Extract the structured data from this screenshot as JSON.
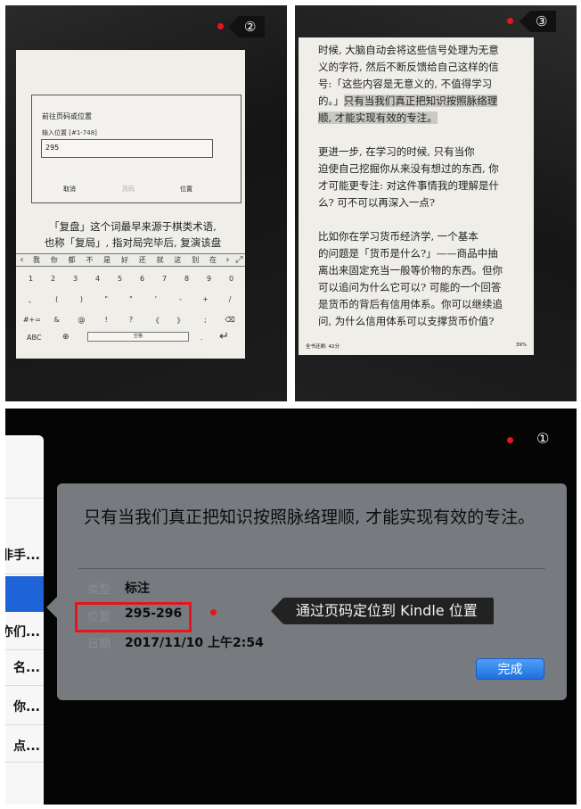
{
  "panel2": {
    "badge": "②",
    "dialog": {
      "title": "前往页码或位置",
      "hint": "输入位置 [#1-748]",
      "input_value": "295",
      "cancel_label": "取消",
      "page_label": "页码",
      "location_label": "位置"
    },
    "body_lines": [
      "「复盘」这个词最早来源于棋类术语,",
      "也称「复局」, 指对局完毕后, 复演该盘"
    ],
    "candidates": [
      "我",
      "你",
      "都",
      "不",
      "是",
      "好",
      "还",
      "就",
      "这",
      "别",
      "在"
    ],
    "keyboard": {
      "row1": [
        "1",
        "2",
        "3",
        "4",
        "5",
        "6",
        "7",
        "8",
        "9",
        "0"
      ],
      "row2": [
        "、",
        "(",
        ")",
        "\"",
        "\"",
        "'",
        "-",
        "+",
        "/"
      ],
      "row3": [
        "#+=",
        "&",
        "@",
        "!",
        "?",
        "《",
        "》",
        ";",
        "⌫"
      ],
      "abc_label": "ABC",
      "globe": "⊕",
      "space_label": "空格",
      "period": ".",
      "enter": "↵"
    }
  },
  "panel3": {
    "badge": "③",
    "lines": [
      {
        "text": "时候, 大脑自动会将这些信号处理为无意",
        "hl": ""
      },
      {
        "text": "义的字符, 然后不断反馈给自己这样的信",
        "hl": ""
      },
      {
        "text": "号:「这些内容是无意义的, 不值得学习",
        "hl": ""
      },
      {
        "text": "的。」",
        "hl": "只有当我们真正把知识按照脉络理"
      },
      {
        "text": "",
        "hl": "顺, 才能实现有效的专注。"
      },
      {
        "text": "",
        "hl": ""
      },
      {
        "text": "    更进一步, 在学习的时候, 只有当你",
        "hl": ""
      },
      {
        "text": "迫使自己挖掘你从来没有想过的东西, 你",
        "hl": ""
      },
      {
        "text": "才可能更专注: 对这件事情我的理解是什",
        "hl": ""
      },
      {
        "text": "么? 可不可以再深入一点?",
        "hl": ""
      },
      {
        "text": "",
        "hl": ""
      },
      {
        "text": "    比如你在学习货币经济学, 一个基本",
        "hl": ""
      },
      {
        "text": "的问题是「货币是什么?」——商品中抽",
        "hl": ""
      },
      {
        "text": "离出来固定充当一般等价物的东西。但你",
        "hl": ""
      },
      {
        "text": "可以追问为什么它可以? 可能的一个回答",
        "hl": ""
      },
      {
        "text": "是货币的背后有信用体系。你可以继续追",
        "hl": ""
      },
      {
        "text": "问, 为什么信用体系可以支撑货币价值?",
        "hl": ""
      }
    ],
    "footer_left": "全书还剩: 42分",
    "footer_right": "39%"
  },
  "panel1": {
    "badge": "①",
    "sidebar_items": [
      "非手...",
      "亦们...",
      "名...",
      "你...",
      "点..."
    ],
    "popover": {
      "title": "只有当我们真正把知识按照脉络理顺, 才能实现有效的专注。",
      "type_label": "类型",
      "type_value": "标注",
      "location_label": "位置",
      "location_value": "295-296",
      "date_label": "日期",
      "date_value": "2017/11/10 上午2:54",
      "done_label": "完成"
    },
    "callout": "通过页码定位到 Kindle 位置"
  },
  "colors": {
    "accent_red": "#e8141c",
    "done_blue": "#1f6fe0",
    "popover_gray": "#777b7f"
  }
}
